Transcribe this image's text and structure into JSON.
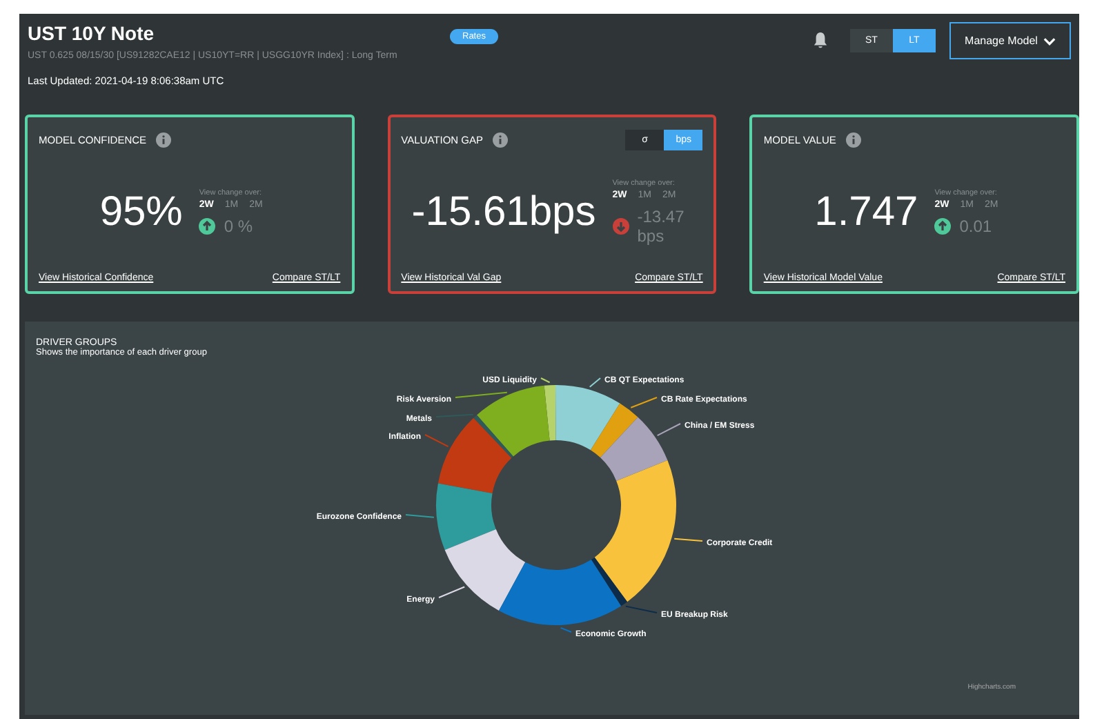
{
  "header": {
    "title": "UST 10Y Note",
    "badge": "Rates",
    "subtitle": "UST 0.625 08/15/30 [US91282CAE12 | US10YT=RR | USGG10YR Index] : Long Term",
    "last_updated": "Last Updated: 2021-04-19 8:06:38am UTC",
    "term_toggle": [
      {
        "label": "ST",
        "selected": false
      },
      {
        "label": "LT",
        "selected": true
      }
    ],
    "manage_button": "Manage Model"
  },
  "cards": [
    {
      "title": "MODEL CONFIDENCE",
      "alert": false,
      "value": "95%",
      "change_label": "View change over:",
      "periods": [
        {
          "label": "2W",
          "selected": true
        },
        {
          "label": "1M",
          "selected": false
        },
        {
          "label": "2M",
          "selected": false
        }
      ],
      "rising": true,
      "change": "0 %",
      "links": [
        "View Historical Confidence",
        "Compare ST/LT"
      ]
    },
    {
      "title": "VALUATION GAP",
      "alert": true,
      "value": "-15.61bps",
      "unit_toggle": [
        {
          "label": "σ",
          "selected": false
        },
        {
          "label": "bps",
          "selected": true
        }
      ],
      "change_label": "View change over:",
      "periods": [
        {
          "label": "2W",
          "selected": true
        },
        {
          "label": "1M",
          "selected": false
        },
        {
          "label": "2M",
          "selected": false
        }
      ],
      "rising": false,
      "change": "-13.47 bps",
      "links": [
        "View Historical Val Gap",
        "Compare ST/LT"
      ]
    },
    {
      "title": "MODEL VALUE",
      "alert": false,
      "value": "1.747",
      "change_label": "View change over:",
      "periods": [
        {
          "label": "2W",
          "selected": true
        },
        {
          "label": "1M",
          "selected": false
        },
        {
          "label": "2M",
          "selected": false
        }
      ],
      "rising": true,
      "change": "0.01",
      "links": [
        "View Historical Model Value",
        "Compare ST/LT"
      ]
    }
  ],
  "driver_groups": {
    "title": "DRIVER GROUPS",
    "subtitle": "Shows the importance of each driver group",
    "credit": "Highcharts.com",
    "slices": [
      {
        "label": "USD Liquidity",
        "color": "#b5d36a"
      },
      {
        "label": "CB QT Expectations",
        "color": "#8fd0d4"
      },
      {
        "label": "Risk Aversion",
        "color": "#7fae1f"
      },
      {
        "label": "CB Rate Expectations",
        "color": "#e0a010"
      },
      {
        "label": "Metals",
        "color": "#2f5a5a"
      },
      {
        "label": "China / EM Stress",
        "color": "#a8a3b8"
      },
      {
        "label": "Inflation",
        "color": "#c23a12"
      },
      {
        "label": "Eurozone Confidence",
        "color": "#2e9c9c"
      },
      {
        "label": "Corporate Credit",
        "color": "#f8c23c"
      },
      {
        "label": "Energy",
        "color": "#dcd9e6"
      },
      {
        "label": "EU Breakup Risk",
        "color": "#0d2c4a"
      },
      {
        "label": "Economic Growth",
        "color": "#0b72c4"
      }
    ]
  }
}
